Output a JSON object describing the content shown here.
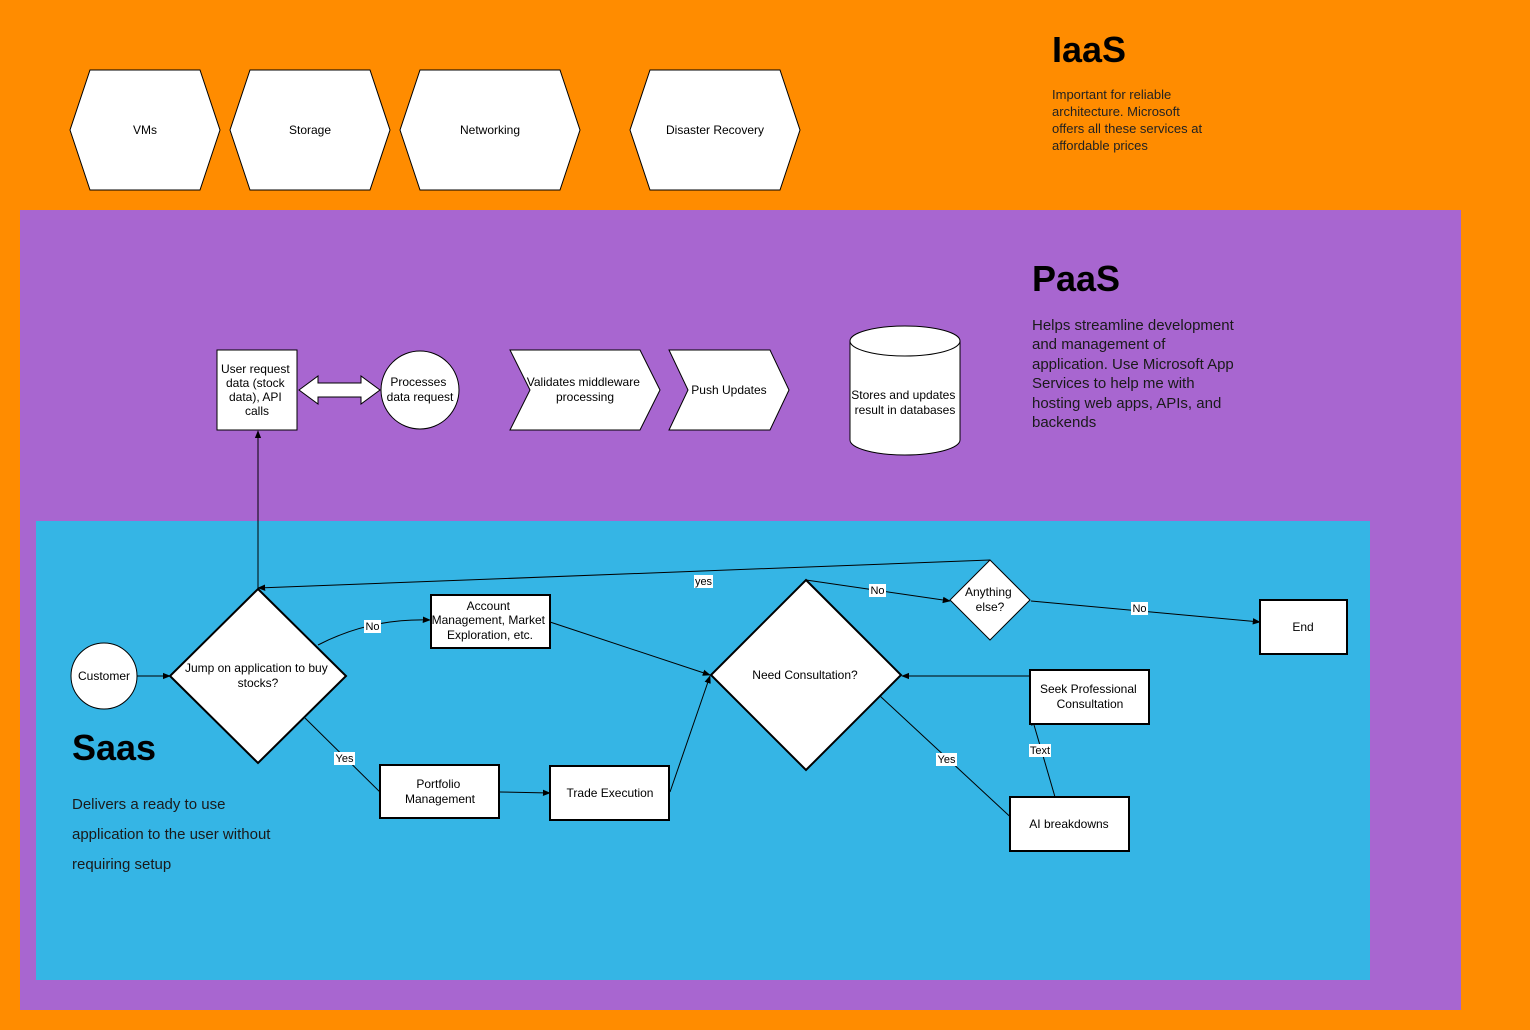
{
  "iaas": {
    "title": "IaaS",
    "desc": [
      "Important for reliable",
      "architecture. Microsoft",
      "offers all these services at",
      "affordable prices"
    ],
    "services": [
      "VMs",
      "Storage",
      "Networking",
      "Disaster Recovery"
    ]
  },
  "paas": {
    "title": "PaaS",
    "desc": [
      "Helps streamline development",
      "and management of",
      "application. Use Microsoft App",
      "Services to help me with",
      "hosting web apps, APIs, and",
      "backends"
    ],
    "user_request": [
      "User request",
      "data (stock",
      "data), API",
      "calls"
    ],
    "processes": [
      "Processes",
      "data request"
    ],
    "validates": [
      "Validates middleware",
      "processing"
    ],
    "push_updates": "Push Updates",
    "database": [
      "Stores and updates",
      "result in databases"
    ]
  },
  "saas": {
    "title": "Saas",
    "desc": [
      "Delivers a ready to use",
      "application to the user without",
      "requiring setup"
    ],
    "customer": "Customer",
    "jump_decision": [
      "Jump on application to buy",
      "stocks?"
    ],
    "account_mgmt": [
      "Account",
      "Management, Market",
      "Exploration, etc."
    ],
    "portfolio": [
      "Portfolio",
      "Management"
    ],
    "trade": "Trade Execution",
    "consult_decision": "Need Consultation?",
    "anything_else": [
      "Anything",
      "else?"
    ],
    "end": "End",
    "seek_pro": [
      "Seek Professional",
      "Consultation"
    ],
    "ai": "AI breakdowns",
    "labels": {
      "no1": "No",
      "yes1": "Yes",
      "yes_loop": "yes",
      "no2": "No",
      "no3": "No",
      "yes2": "Yes",
      "text": "Text"
    }
  },
  "colors": {
    "iaas_bg": "#ff8c00",
    "paas_bg": "#a866d0",
    "saas_bg": "#35b5e5"
  }
}
